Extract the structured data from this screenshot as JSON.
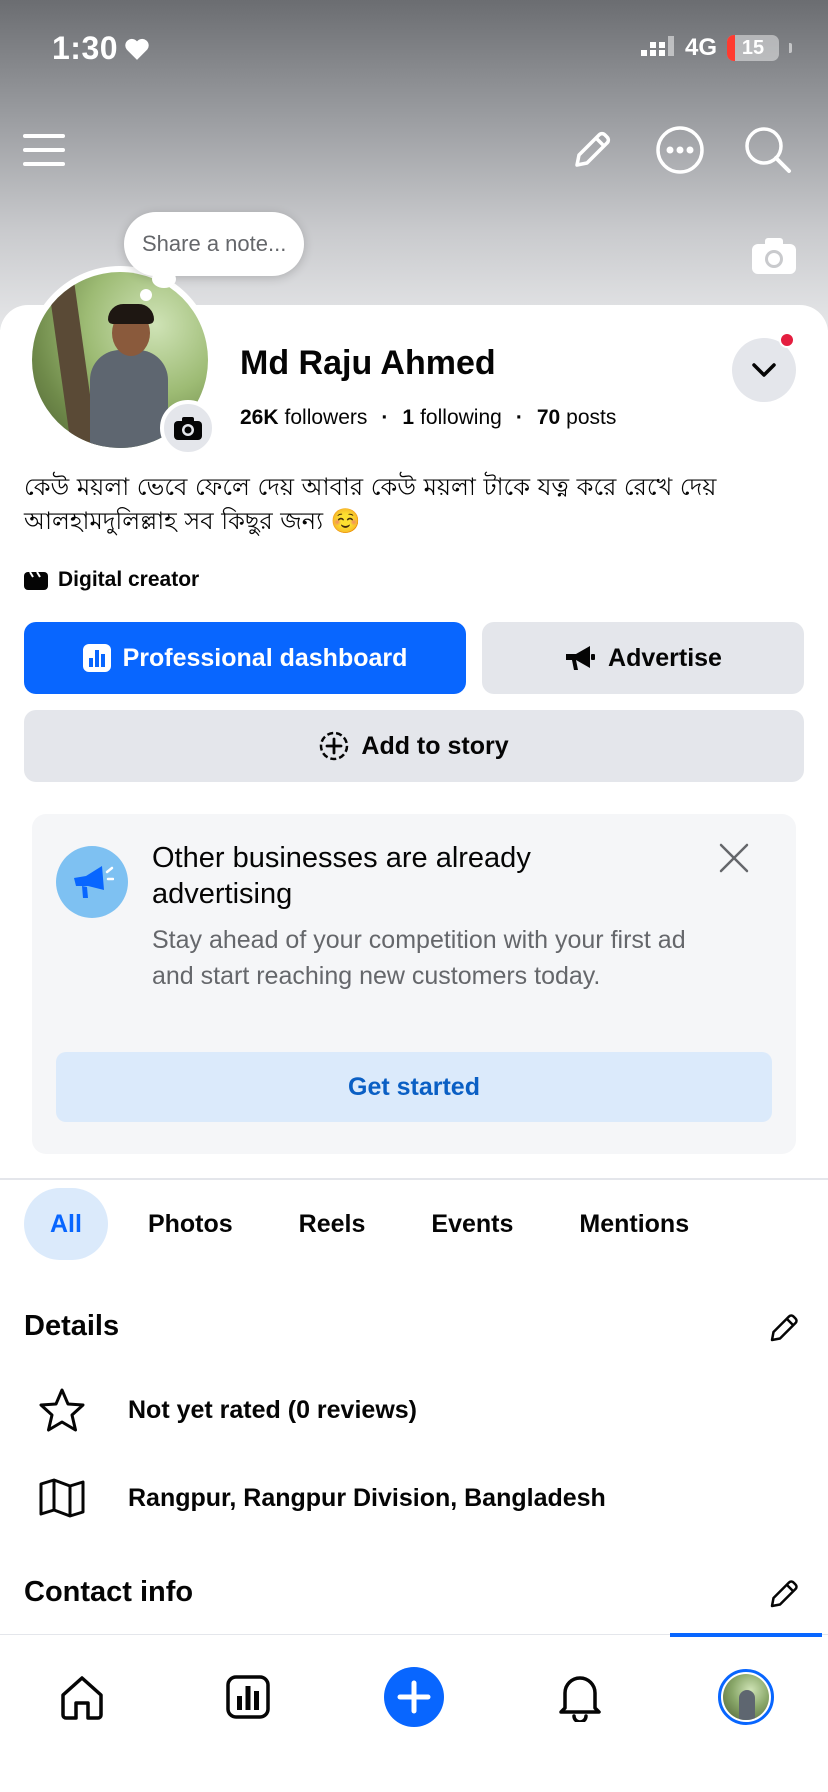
{
  "status_bar": {
    "time": "1:30",
    "network": "4G",
    "battery": "15",
    "battery_level_percent": 15
  },
  "note": {
    "placeholder": "Share a note..."
  },
  "profile": {
    "name": "Md Raju Ahmed",
    "followers_count": "26K",
    "followers_label": "followers",
    "following_count": "1",
    "following_label": "following",
    "posts_count": "70",
    "posts_label": "posts",
    "bio_line1": "কেউ ময়লা ভেবে ফেলে দেয় আবার কেউ ময়লা টাকে যত্ন করে রেখে দেয়",
    "bio_line2": "আলহামদুলিল্লাহ সব কিছুর জন্য ☺️",
    "category": "Digital creator"
  },
  "actions": {
    "professional_dashboard": "Professional dashboard",
    "advertise": "Advertise",
    "add_to_story": "Add to story"
  },
  "promo": {
    "title": "Other businesses are already advertising",
    "text": "Stay ahead of your competition with your first ad and start reaching new customers today.",
    "button": "Get started"
  },
  "tabs": [
    {
      "label": "All",
      "active": true
    },
    {
      "label": "Photos",
      "active": false
    },
    {
      "label": "Reels",
      "active": false
    },
    {
      "label": "Events",
      "active": false
    },
    {
      "label": "Mentions",
      "active": false
    }
  ],
  "details": {
    "title": "Details",
    "rating": "Not yet rated (0 reviews)",
    "location": "Rangpur, Rangpur Division, Bangladesh"
  },
  "contact": {
    "title": "Contact info"
  },
  "bottom_nav": {
    "items": [
      "home-icon",
      "dashboard-icon",
      "create-icon",
      "notifications-icon",
      "profile-avatar"
    ],
    "active": "profile-avatar"
  },
  "colors": {
    "brand_blue": "#0866ff",
    "light_blue": "#dbeafb",
    "gray_button": "#e4e6eb",
    "notification_red": "#e41e3f"
  }
}
